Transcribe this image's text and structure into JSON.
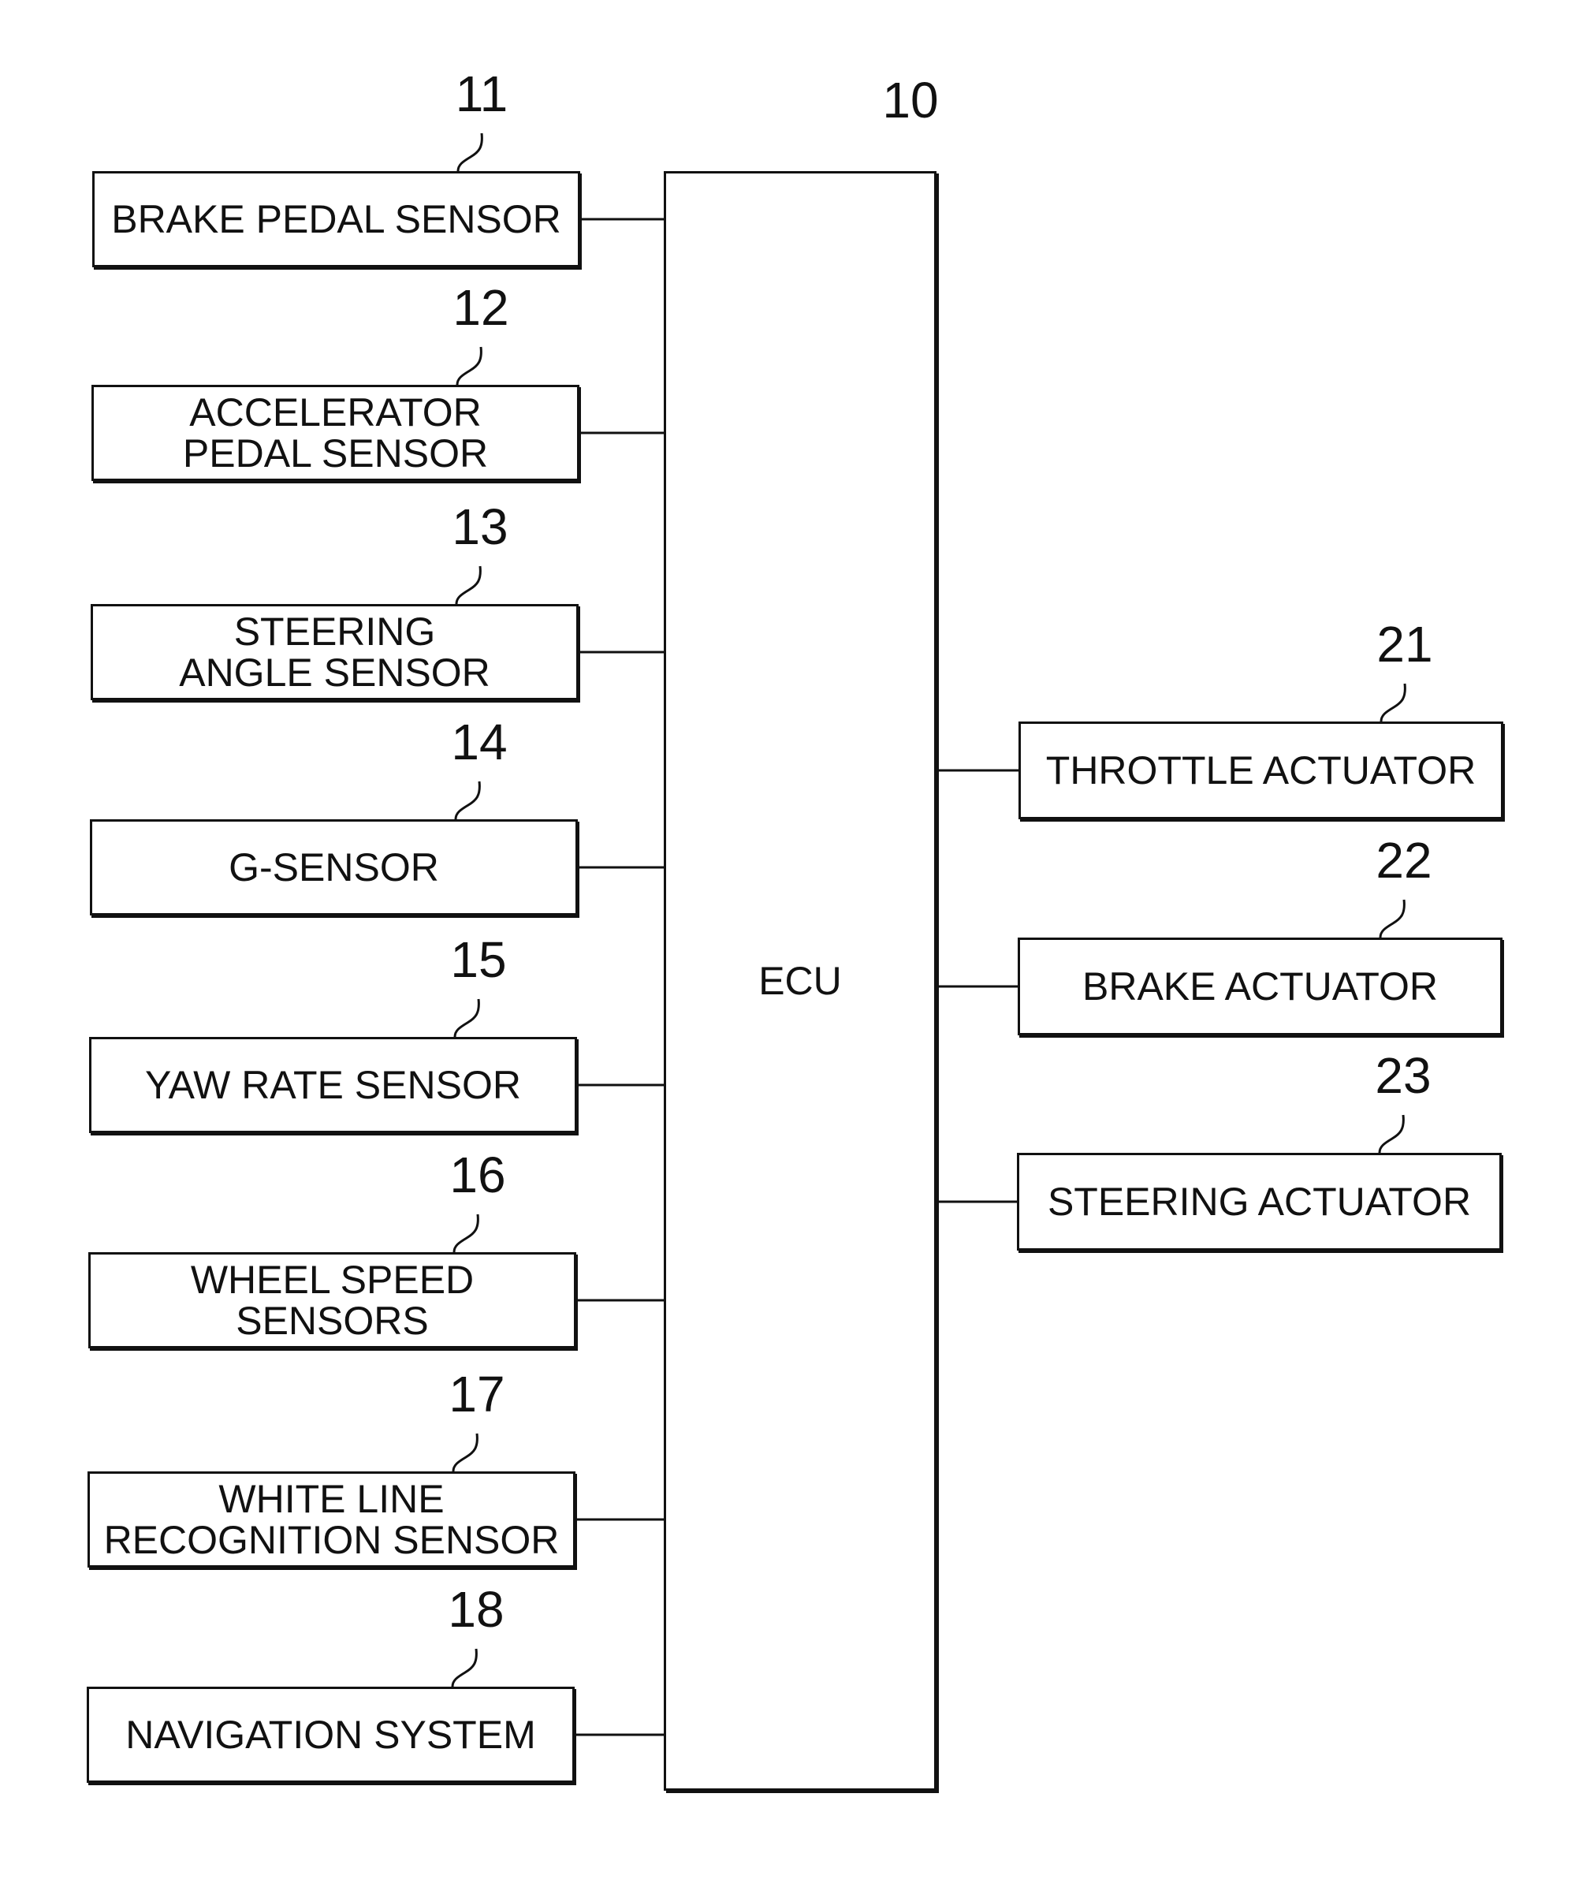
{
  "ecu": {
    "ref": "10",
    "label": "ECU"
  },
  "inputs": [
    {
      "ref": "11",
      "label": "BRAKE PEDAL SENSOR"
    },
    {
      "ref": "12",
      "label": "ACCELERATOR\nPEDAL SENSOR"
    },
    {
      "ref": "13",
      "label": "STEERING\nANGLE SENSOR"
    },
    {
      "ref": "14",
      "label": "G-SENSOR"
    },
    {
      "ref": "15",
      "label": "YAW RATE SENSOR"
    },
    {
      "ref": "16",
      "label": "WHEEL SPEED\nSENSORS"
    },
    {
      "ref": "17",
      "label": "WHITE LINE\nRECOGNITION SENSOR"
    },
    {
      "ref": "18",
      "label": "NAVIGATION SYSTEM"
    }
  ],
  "outputs": [
    {
      "ref": "21",
      "label": "THROTTLE ACTUATOR"
    },
    {
      "ref": "22",
      "label": "BRAKE ACTUATOR"
    },
    {
      "ref": "23",
      "label": "STEERING ACTUATOR"
    }
  ]
}
